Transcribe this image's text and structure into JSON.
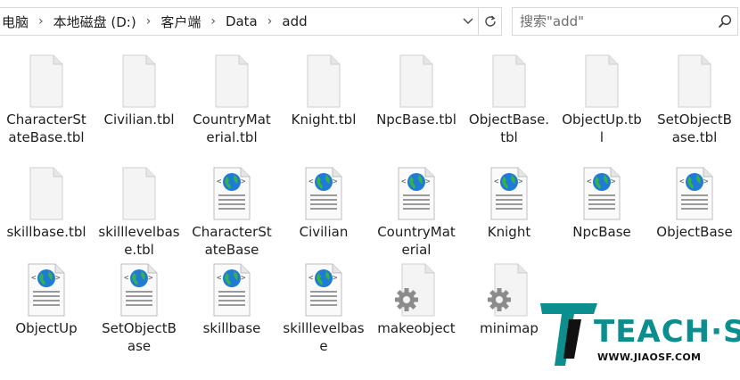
{
  "address": {
    "crumbs": [
      "电脑",
      "本地磁盘 (D:)",
      "客户端",
      "Data",
      "add"
    ]
  },
  "search": {
    "placeholder": "搜索\"add\""
  },
  "files": [
    {
      "name": "CharacterStateBase.tbl",
      "label": "CharacterS tateBase.t bl",
      "type": "blank"
    },
    {
      "name": "Civilian.tbl",
      "label": "Civilian.tbl",
      "type": "blank"
    },
    {
      "name": "CountryMaterial.tbl",
      "label": "CountryM aterial.tbl",
      "type": "blank"
    },
    {
      "name": "Knight.tbl",
      "label": "Knight.tbl",
      "type": "blank"
    },
    {
      "name": "NpcBase.tbl",
      "label": "NpcBase.t bl",
      "type": "blank"
    },
    {
      "name": "ObjectBase.tbl",
      "label": "ObjectBas e.tbl",
      "type": "blank"
    },
    {
      "name": "ObjectUp.tbl",
      "label": "ObjectUp. tbl",
      "type": "blank"
    },
    {
      "name": "SetObjectBase.tbl",
      "label": "SetObject Base.tbl",
      "type": "blank"
    },
    {
      "name": "skillbase.tbl",
      "label": "skillbase.t bl",
      "type": "blank"
    },
    {
      "name": "skilllevelbase.tbl",
      "label": "skilllevelba se.tbl",
      "type": "blank"
    },
    {
      "name": "CharacterStateBase",
      "label": "CharacterS tateBase",
      "type": "web"
    },
    {
      "name": "Civilian",
      "label": "Civilian",
      "type": "web"
    },
    {
      "name": "CountryMaterial",
      "label": "CountryM aterial",
      "type": "web"
    },
    {
      "name": "Knight",
      "label": "Knight",
      "type": "web"
    },
    {
      "name": "NpcBase",
      "label": "NpcBase",
      "type": "web"
    },
    {
      "name": "ObjectBase",
      "label": "ObjectBas e",
      "type": "web"
    },
    {
      "name": "ObjectUp",
      "label": "ObjectUp",
      "type": "web"
    },
    {
      "name": "SetObjectBase",
      "label": "SetObject Base",
      "type": "web"
    },
    {
      "name": "skillbase",
      "label": "skillbase",
      "type": "web"
    },
    {
      "name": "skilllevelbase",
      "label": "skilllevelba se",
      "type": "web"
    },
    {
      "name": "makeobject",
      "label": "makeobje ct",
      "type": "exe"
    },
    {
      "name": "minimap",
      "label": "minimap",
      "type": "exe"
    }
  ],
  "watermark": {
    "brand": "TEACH·SF",
    "url": "WWW.JIAOSF.COM"
  },
  "colors": {
    "accent": "#0d8e8e",
    "border": "#d9d9d9"
  }
}
